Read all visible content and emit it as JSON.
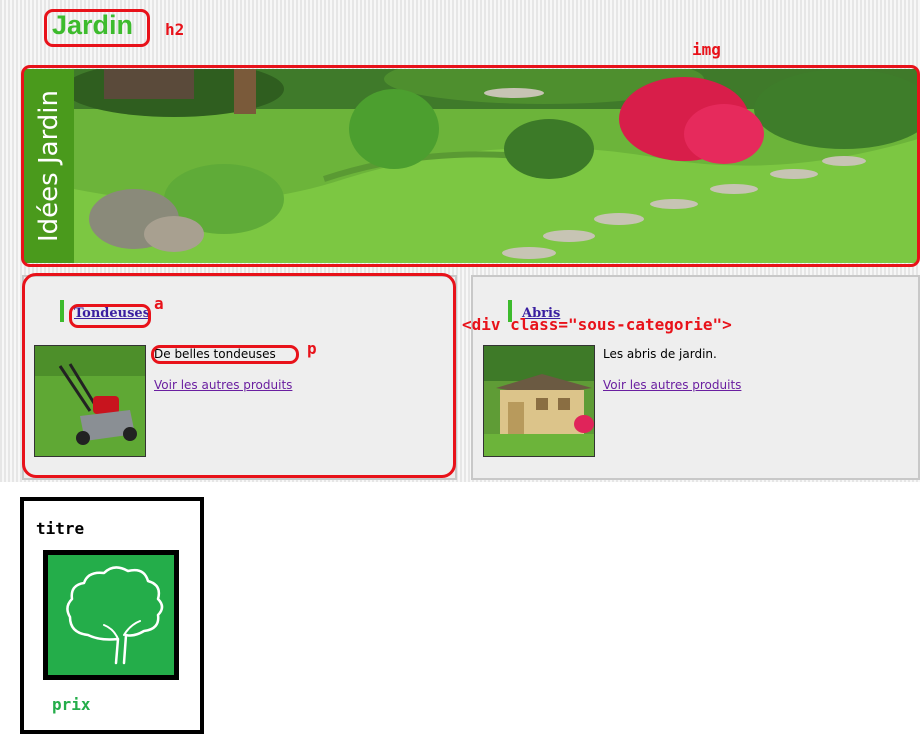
{
  "heading": {
    "text": "Jardin"
  },
  "banner": {
    "side_text": "Idées Jardin"
  },
  "annotations": {
    "h2": "h2",
    "img": "img",
    "a": "a",
    "p": "p",
    "div": "<div class=\"sous-categorie\">"
  },
  "categories": [
    {
      "title": "Tondeuses",
      "description": "De belles tondeuses",
      "more": "Voir les autres produits",
      "image": "lawnmower-photo"
    },
    {
      "title": "Abris",
      "description": "Les abris de jardin.",
      "more": "Voir les autres produits",
      "image": "garden-shed-photo"
    }
  ],
  "sketch": {
    "title": "titre",
    "price": "prix",
    "image": "tree-icon"
  },
  "colors": {
    "annotation_red": "#e8121a",
    "heading_green": "#3dbb2d",
    "sketch_green": "#24ad4a",
    "link_blue": "#3a1fa0"
  }
}
